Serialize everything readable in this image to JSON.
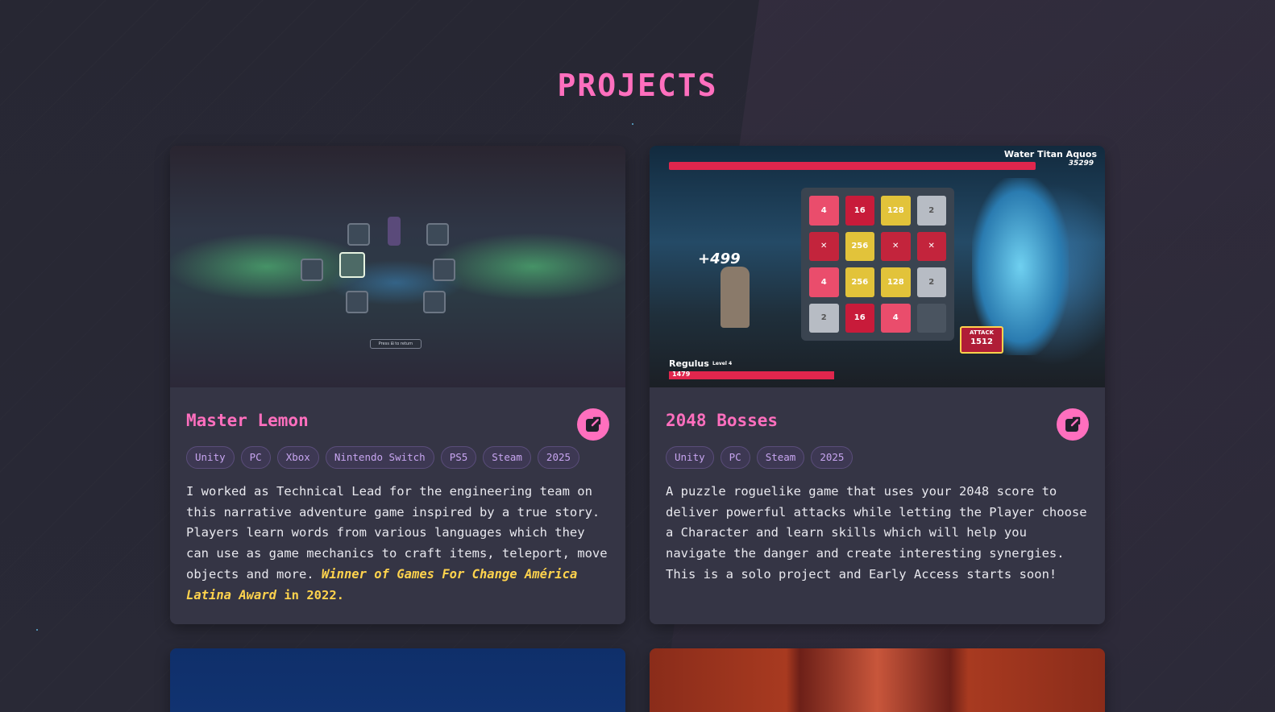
{
  "section": {
    "title": "PROJECTS"
  },
  "projects": [
    {
      "title": "Master Lemon",
      "tags": [
        "Unity",
        "PC",
        "Xbox",
        "Nintendo Switch",
        "PS5",
        "Steam",
        "2025"
      ],
      "description": "I worked as Technical Lead for the engineering team on this narrative adventure game inspired by a true story. Players learn words from various languages which they can use as game mechanics to craft items, teleport, move objects and more.",
      "award_prefix": "Winner of",
      "award_name": "Games For Change América Latina Award",
      "award_suffix": "in 2022.",
      "screenshot_hint": "Press ⊞ to return",
      "link_icon": "external-link-icon"
    },
    {
      "title": "2048 Bosses",
      "tags": [
        "Unity",
        "PC",
        "Steam",
        "2025"
      ],
      "description": "A puzzle roguelike game that uses your 2048 score to deliver powerful attacks while letting the Player choose a Character and learn skills which will help you navigate the danger and create interesting synergies. This is a solo project and Early Access starts soon!",
      "game_ui": {
        "boss_name": "Water Titan Aquos",
        "boss_hp": "35299",
        "damage_popup": "+499",
        "player_name": "Regulus",
        "player_level": "Level 4",
        "player_hp": "1479",
        "attack_label": "ATTACK",
        "attack_value": "1512",
        "tiles": [
          "4",
          "16",
          "128",
          "2",
          "x",
          "256",
          "x",
          "x",
          "4",
          "256",
          "128",
          "2",
          "2",
          "16",
          "4",
          ""
        ]
      },
      "link_icon": "external-link-icon"
    }
  ],
  "colors": {
    "accent": "#ff6fbe",
    "highlight": "#ffd34d",
    "tag_text": "#c7a5f0",
    "card_bg": "#353545",
    "page_bg": "#272733"
  }
}
